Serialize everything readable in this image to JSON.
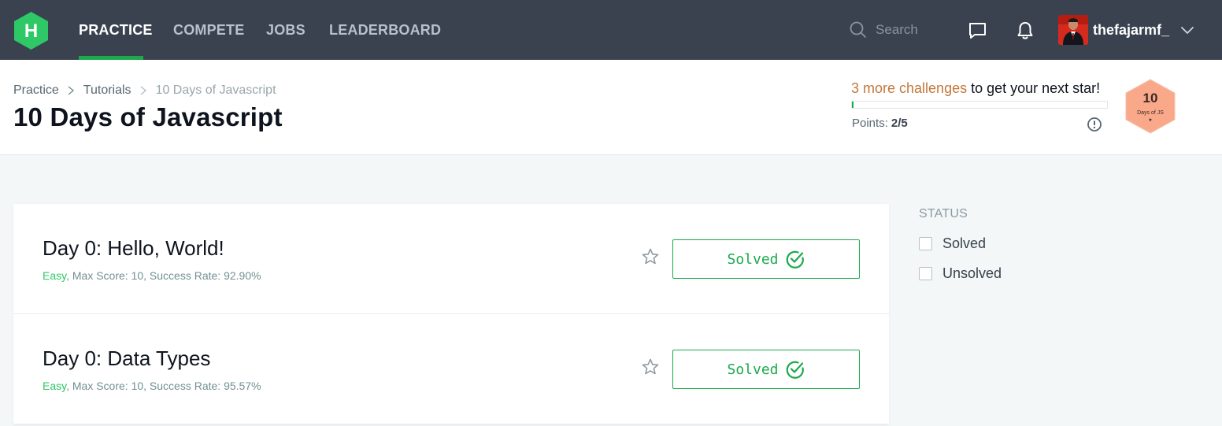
{
  "nav": {
    "logo_letter": "H",
    "items": [
      {
        "label": "PRACTICE",
        "active": true
      },
      {
        "label": "COMPETE",
        "active": false
      },
      {
        "label": "JOBS",
        "active": false
      },
      {
        "label": "LEADERBOARD",
        "active": false
      }
    ],
    "search_placeholder": "Search",
    "username": "thefajarmf_",
    "icons": [
      "search-icon",
      "messages-icon",
      "bell-icon",
      "chevron-down-icon"
    ]
  },
  "header": {
    "breadcrumb": [
      "Practice",
      "Tutorials",
      "10 Days of Javascript"
    ],
    "title": "10 Days of Javascript",
    "star_msg_link": "3 more challenges",
    "star_msg_rest": " to get your next star!",
    "progress_fraction": 0.0,
    "points_label": "Points:",
    "points_value": "2/5",
    "badge": {
      "number": "10",
      "subtitle": "Days of JS",
      "color": "#f9a98a"
    }
  },
  "challenges": [
    {
      "title": "Day 0: Hello, World!",
      "difficulty": "Easy",
      "meta": ", Max Score: 10, Success Rate: 92.90%",
      "status": "Solved"
    },
    {
      "title": "Day 0: Data Types",
      "difficulty": "Easy",
      "meta": ", Max Score: 10, Success Rate: 95.57%",
      "status": "Solved"
    }
  ],
  "sidebar": {
    "status_heading": "STATUS",
    "options": [
      "Solved",
      "Unsolved"
    ]
  },
  "colors": {
    "nav_bg": "#39424e",
    "brand_green": "#1ba94c",
    "link_orange": "#c3773a",
    "page_bg": "#f3f7f7"
  }
}
